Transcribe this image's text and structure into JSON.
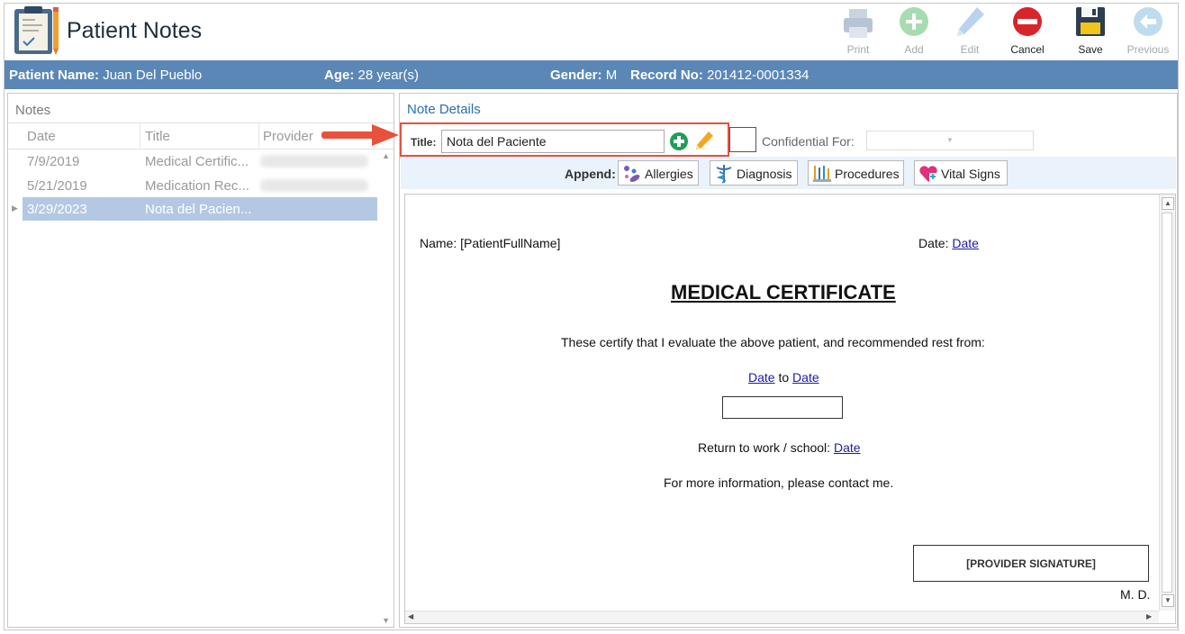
{
  "app": {
    "title": "Patient Notes",
    "logo_icon": "clipboard-note-icon"
  },
  "toolbar": [
    {
      "label": "Print",
      "icon": "printer-icon",
      "enabled": false
    },
    {
      "label": "Add",
      "icon": "plus-circle-icon",
      "enabled": false
    },
    {
      "label": "Edit",
      "icon": "pencil-icon",
      "enabled": false
    },
    {
      "label": "Cancel",
      "icon": "minus-circle-icon",
      "enabled": true
    },
    {
      "label": "Save",
      "icon": "floppy-disk-icon",
      "enabled": true
    },
    {
      "label": "Previous",
      "icon": "arrow-left-circle-icon",
      "enabled": false
    }
  ],
  "patient": {
    "name_label": "Patient Name:",
    "name": "Juan Del Pueblo",
    "age_label": "Age:",
    "age": "28 year(s)",
    "gender_label": "Gender:",
    "gender": "M",
    "record_label": "Record No:",
    "record": "201412-0001334"
  },
  "notes_panel": {
    "title": "Notes",
    "columns": [
      "Date",
      "Title",
      "Provider"
    ],
    "rows": [
      {
        "date": "7/9/2019",
        "title": "Medical Certific...",
        "selected": false
      },
      {
        "date": "5/21/2019",
        "title": "Medication Rec...",
        "selected": false
      },
      {
        "date": "3/29/2023",
        "title": "Nota del Pacien...",
        "selected": true
      }
    ]
  },
  "note_details": {
    "title": "Note Details",
    "title_label": "Title:",
    "title_value": "Nota del Paciente",
    "confidential_label": "Confidential For:",
    "append_label": "Append:",
    "append_buttons": [
      {
        "label": "Allergies",
        "icon": "pills-icon"
      },
      {
        "label": "Diagnosis",
        "icon": "caduceus-icon"
      },
      {
        "label": "Procedures",
        "icon": "medical-tools-icon"
      },
      {
        "label": "Vital Signs",
        "icon": "heart-pulse-icon"
      }
    ]
  },
  "document": {
    "name_line": "Name: [PatientFullName]",
    "date_label": "Date:",
    "date_link": "Date",
    "heading": "MEDICAL CERTIFICATE",
    "certify_text": "These certify that I evaluate the above patient, and recommended rest from:",
    "range_from": "Date",
    "range_to_word": "to",
    "range_to": "Date",
    "return_label": "Return to work / school:",
    "return_date": "Date",
    "contact_text": "For more information, please contact me.",
    "signature": "[PROVIDER SIGNATURE]",
    "md": "M. D."
  },
  "colors": {
    "patient_bar": "#5b87b7",
    "selected_row": "#b4c8e4",
    "highlight": "#e0533f",
    "link": "#1a1aa6"
  }
}
